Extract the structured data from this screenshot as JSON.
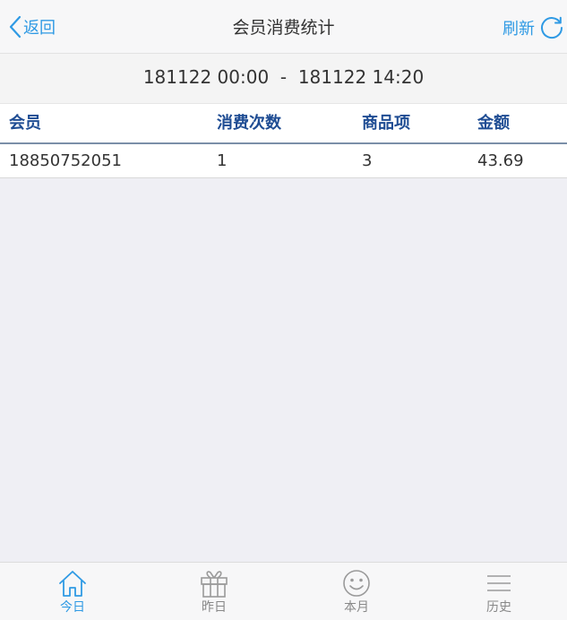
{
  "navbar": {
    "back_label": "返回",
    "title": "会员消费统计",
    "refresh_label": "刷新"
  },
  "date_range": {
    "start": "181122 00:00",
    "separator": "-",
    "end": "181122 14:20"
  },
  "table": {
    "headers": [
      "会员",
      "消费次数",
      "商品项",
      "金额"
    ],
    "rows": [
      [
        "18850752051",
        "1",
        "3",
        "43.69"
      ]
    ]
  },
  "tabbar": {
    "items": [
      {
        "label": "今日",
        "icon": "home-icon",
        "active": true
      },
      {
        "label": "昨日",
        "icon": "gift-icon",
        "active": false
      },
      {
        "label": "本月",
        "icon": "smiley-icon",
        "active": false
      },
      {
        "label": "历史",
        "icon": "menu-icon",
        "active": false
      }
    ]
  },
  "colors": {
    "accent": "#2f9ae4",
    "header_text": "#1e4c93",
    "inactive_icon": "#9a9a9a"
  }
}
